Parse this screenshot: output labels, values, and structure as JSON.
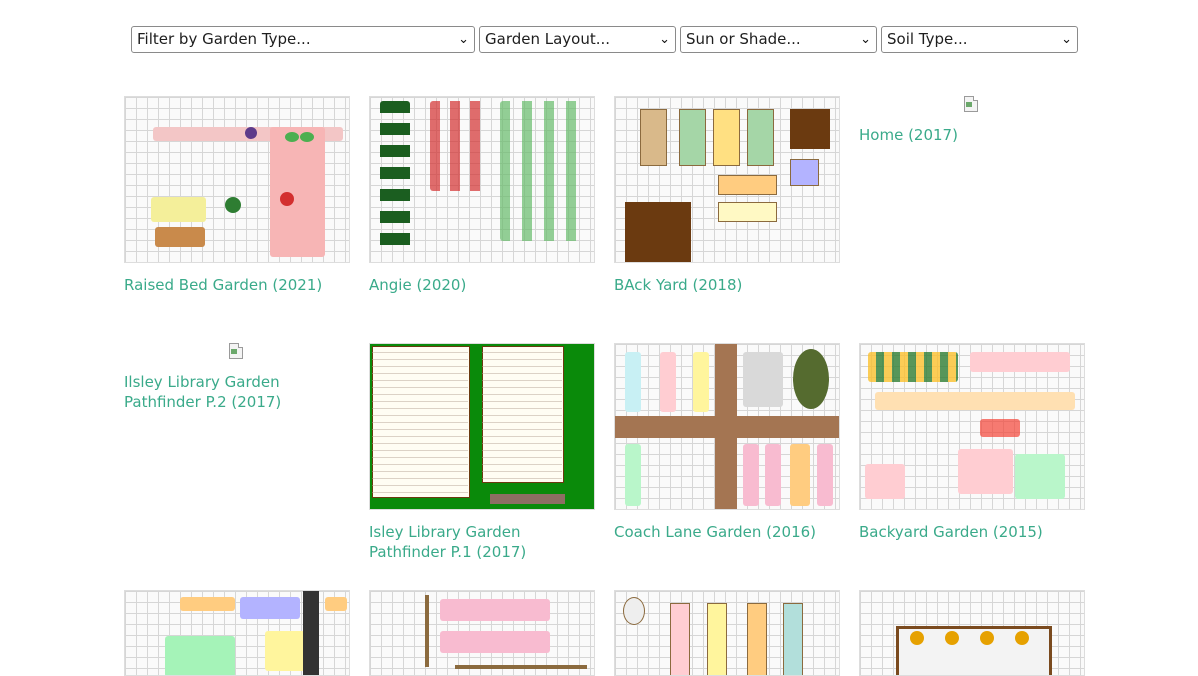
{
  "filters": [
    {
      "label": "Filter by Garden Type..."
    },
    {
      "label": "Garden Layout..."
    },
    {
      "label": "Sun or Shade..."
    },
    {
      "label": "Soil Type..."
    }
  ],
  "gardens": [
    {
      "title": "Raised Bed Garden (2021)"
    },
    {
      "title": "Angie (2020)"
    },
    {
      "title": "BAck Yard (2018)"
    },
    {
      "title": "Home (2017)"
    },
    {
      "title": "Ilsley Library Garden Pathfinder P.2 (2017)"
    },
    {
      "title": "Isley Library Garden Pathfinder P.1 (2017)"
    },
    {
      "title": "Coach Lane Garden (2016)"
    },
    {
      "title": "Backyard Garden (2015)"
    }
  ],
  "colors": {
    "link": "#3aaa8a",
    "grid": "#d6d6d6",
    "soil_brown": "#6b3a10",
    "plant_green": "#2e7d32",
    "tomato_red": "#d32f2f",
    "pathfinder_green": "#0a8a0a"
  }
}
